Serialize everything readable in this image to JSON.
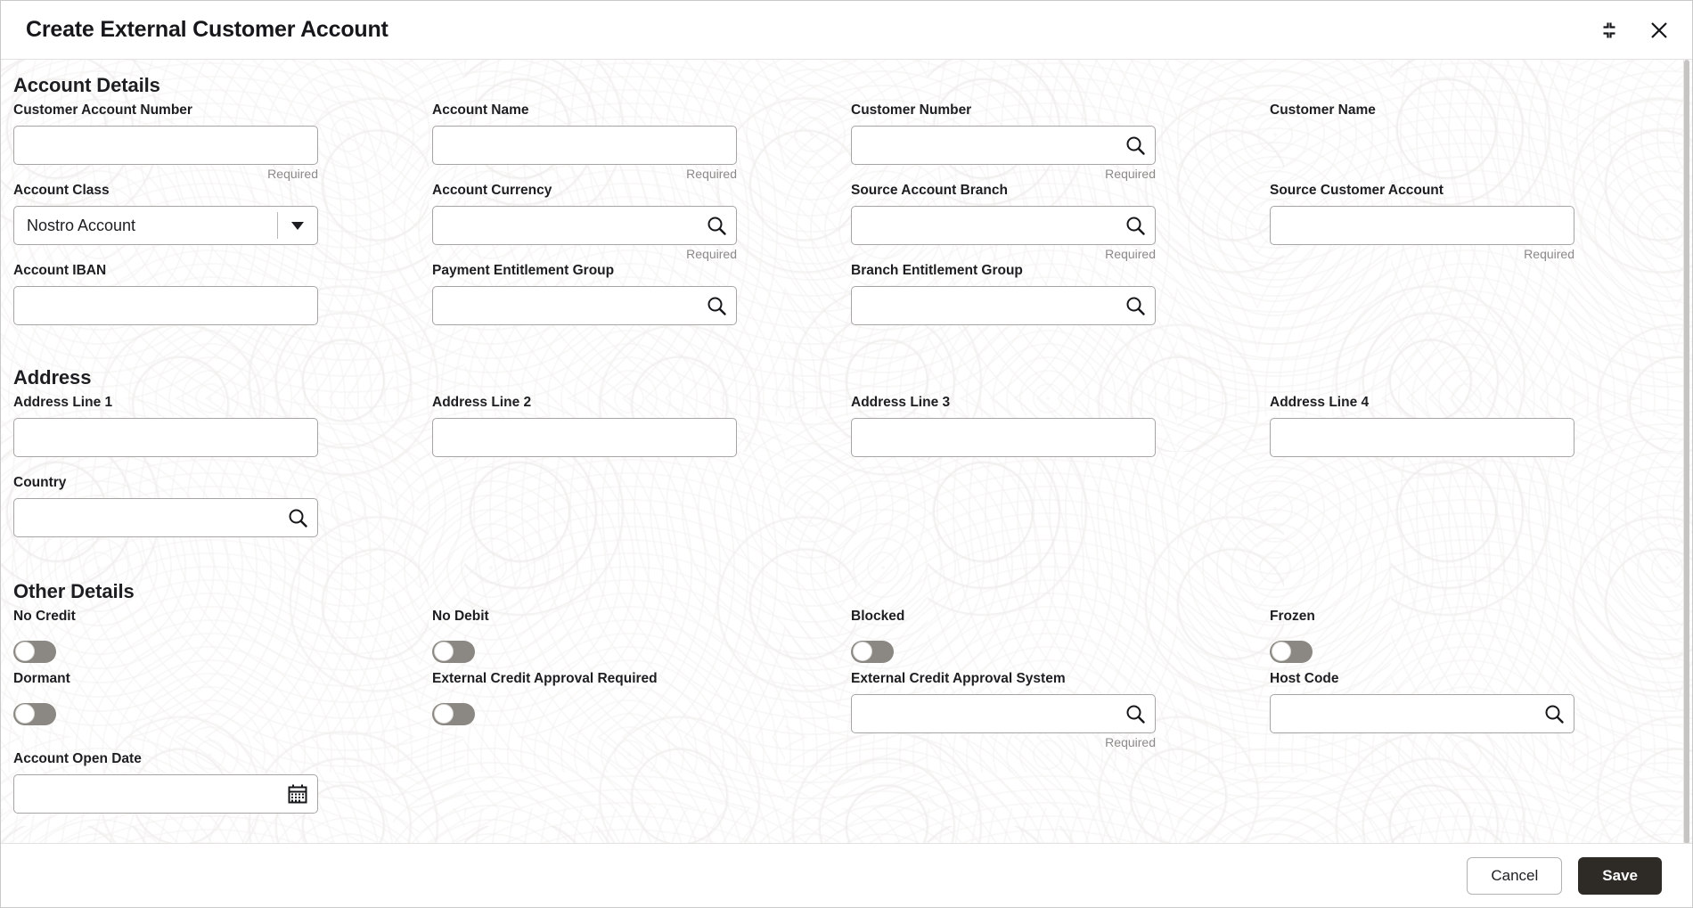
{
  "window": {
    "title": "Create External Customer Account",
    "minimize_icon": "collapse-icon",
    "close_icon": "close-icon"
  },
  "required_note": "Required",
  "sections": {
    "account_details": {
      "title": "Account Details",
      "fields": [
        {
          "label": "Customer Account Number",
          "type": "text",
          "value": "",
          "note": "Required",
          "icon": ""
        },
        {
          "label": "Account Name",
          "type": "text",
          "value": "",
          "note": "Required",
          "icon": ""
        },
        {
          "label": "Customer Number",
          "type": "lookup",
          "value": "",
          "note": "Required",
          "icon": "search-icon"
        },
        {
          "label": "Customer Name",
          "type": "display",
          "value": "",
          "note": "",
          "icon": ""
        },
        {
          "label": "Account Class",
          "type": "select",
          "value": "Nostro Account",
          "note": "",
          "icon": "chevron-down-icon"
        },
        {
          "label": "Account Currency",
          "type": "lookup",
          "value": "",
          "note": "Required",
          "icon": "search-icon"
        },
        {
          "label": "Source Account Branch",
          "type": "lookup",
          "value": "",
          "note": "Required",
          "icon": "search-icon"
        },
        {
          "label": "Source Customer Account",
          "type": "text",
          "value": "",
          "note": "Required",
          "icon": ""
        },
        {
          "label": "Account IBAN",
          "type": "text",
          "value": "",
          "note": "",
          "icon": ""
        },
        {
          "label": "Payment Entitlement Group",
          "type": "lookup",
          "value": "",
          "note": "",
          "icon": "search-icon"
        },
        {
          "label": "Branch Entitlement Group",
          "type": "lookup",
          "value": "",
          "note": "",
          "icon": "search-icon"
        }
      ]
    },
    "address": {
      "title": "Address",
      "fields": [
        {
          "label": "Address Line 1",
          "type": "text",
          "value": "",
          "note": "",
          "icon": ""
        },
        {
          "label": "Address Line 2",
          "type": "text",
          "value": "",
          "note": "",
          "icon": ""
        },
        {
          "label": "Address Line 3",
          "type": "text",
          "value": "",
          "note": "",
          "icon": ""
        },
        {
          "label": "Address Line 4",
          "type": "text",
          "value": "",
          "note": "",
          "icon": ""
        },
        {
          "label": "Country",
          "type": "lookup",
          "value": "",
          "note": "",
          "icon": "search-icon"
        }
      ]
    },
    "other_details": {
      "title": "Other Details",
      "fields": [
        {
          "label": "No Credit",
          "type": "toggle",
          "value": "off",
          "note": "",
          "icon": ""
        },
        {
          "label": "No Debit",
          "type": "toggle",
          "value": "off",
          "note": "",
          "icon": ""
        },
        {
          "label": "Blocked",
          "type": "toggle",
          "value": "off",
          "note": "",
          "icon": ""
        },
        {
          "label": "Frozen",
          "type": "toggle",
          "value": "off",
          "note": "",
          "icon": ""
        },
        {
          "label": "Dormant",
          "type": "toggle",
          "value": "off",
          "note": "",
          "icon": ""
        },
        {
          "label": "External Credit Approval Required",
          "type": "toggle",
          "value": "off",
          "note": "",
          "icon": ""
        },
        {
          "label": "External Credit Approval System",
          "type": "lookup",
          "value": "",
          "note": "Required",
          "icon": "search-icon"
        },
        {
          "label": "Host Code",
          "type": "lookup",
          "value": "",
          "note": "",
          "icon": "search-icon"
        },
        {
          "label": "Account Open Date",
          "type": "date",
          "value": "",
          "note": "",
          "icon": "calendar-icon"
        }
      ]
    }
  },
  "footer": {
    "cancel_label": "Cancel",
    "save_label": "Save"
  },
  "colors": {
    "save_button_bg": "#2e2b27",
    "toggle_off_track": "#8b8782",
    "border": "#a6a5a3",
    "note_text": "#8b8a88"
  }
}
